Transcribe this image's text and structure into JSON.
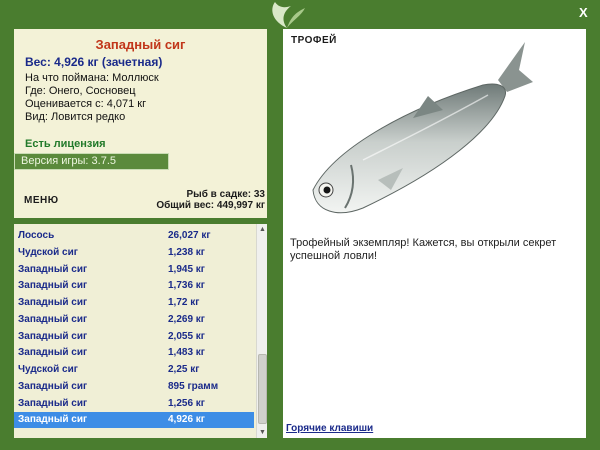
{
  "fish": {
    "title": "Западный сиг",
    "weight": "Вес: 4,926 кг (зачетная)",
    "caught_on": "На что поймана: Моллюск",
    "where": "Где: Онего, Сосновец",
    "valued": "Оценивается с: 4,071 кг",
    "kind": "Вид: Ловится редко"
  },
  "license": "Есть лицензия",
  "version": "Версия игры: 3.7.5",
  "menu_label": "МЕНЮ",
  "keepnet": {
    "count": "Рыб в садке: 33",
    "total": "Общий вес: 449,997 кг"
  },
  "catch_list": [
    {
      "name": "Лосось",
      "weight": "26,027 кг"
    },
    {
      "name": "Чудской сиг",
      "weight": "1,238 кг"
    },
    {
      "name": "Западный сиг",
      "weight": "1,945 кг"
    },
    {
      "name": "Западный сиг",
      "weight": "1,736 кг"
    },
    {
      "name": "Западный сиг",
      "weight": "1,72 кг"
    },
    {
      "name": "Западный сиг",
      "weight": "2,269 кг"
    },
    {
      "name": "Западный сиг",
      "weight": "2,055 кг"
    },
    {
      "name": "Западный сиг",
      "weight": "1,483 кг"
    },
    {
      "name": "Чудской сиг",
      "weight": "2,25 кг"
    },
    {
      "name": "Западный сиг",
      "weight": "895 грамм"
    },
    {
      "name": "Западный сиг",
      "weight": "1,256 кг"
    },
    {
      "name": "Западный сиг",
      "weight": "4,926 кг"
    }
  ],
  "selected_index": 11,
  "trophy": {
    "label": "ТРОФЕЙ",
    "text": "Трофейный экземпляр! Кажется, вы открыли секрет успешной ловли!"
  },
  "hotkeys": "Горячие клавиши",
  "close": "X",
  "colors": {
    "frame": "#4a7d2f",
    "panel": "#f3f2d7",
    "selected": "#3d8de6",
    "title": "#c1361a",
    "list_text": "#1a2a8a"
  }
}
